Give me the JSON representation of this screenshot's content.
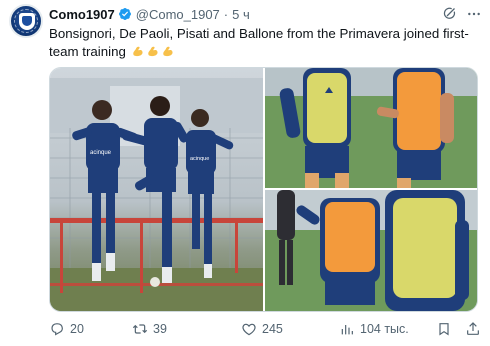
{
  "author": {
    "name": "Como1907",
    "handle": "@Como_1907",
    "separator": "·",
    "time": "5 ч",
    "verified_color": "#1d9bf0"
  },
  "tweet": {
    "text": "Bonsignori, De Paoli, Pisati and Ballone from the Primavera joined first-team training",
    "emoji": [
      "flexed-biceps",
      "flexed-biceps",
      "flexed-biceps"
    ]
  },
  "media": {
    "photo_count": 3,
    "sponsor_text": "acinque",
    "kit_color": "#1f3e7a",
    "bib_orange": "#f39a3c",
    "bib_yellow": "#d9d86a"
  },
  "actions": {
    "replies": "20",
    "retweets": "39",
    "likes": "245",
    "views": "104 тыс."
  },
  "icons": {
    "reply": "reply-icon",
    "retweet": "retweet-icon",
    "like": "heart-icon",
    "views": "views-icon",
    "bookmark": "bookmark-icon",
    "share": "share-icon",
    "grok": "grok-icon",
    "more": "more-icon"
  }
}
